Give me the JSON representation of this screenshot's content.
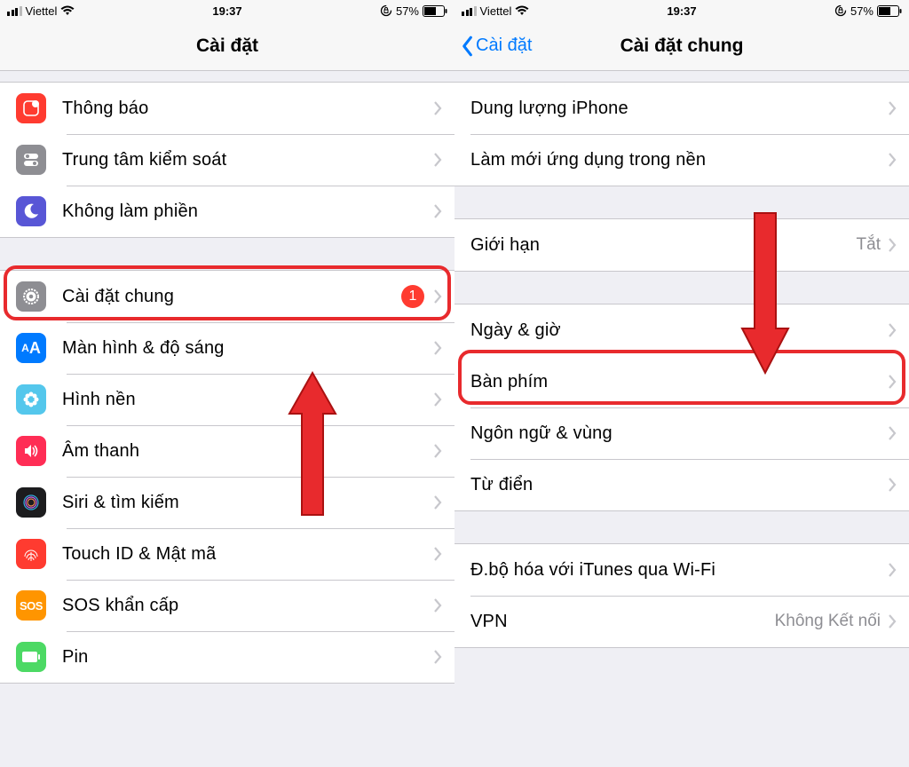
{
  "status": {
    "carrier": "Viettel",
    "time": "19:37",
    "battery": "57%"
  },
  "left": {
    "title": "Cài đặt",
    "badge": "1",
    "rows1": [
      {
        "label": "Thông báo"
      },
      {
        "label": "Trung tâm kiểm soát"
      },
      {
        "label": "Không làm phiền"
      }
    ],
    "rows2": [
      {
        "label": "Cài đặt chung"
      },
      {
        "label": "Màn hình & độ sáng"
      },
      {
        "label": "Hình nền"
      },
      {
        "label": "Âm thanh"
      },
      {
        "label": "Siri & tìm kiếm"
      },
      {
        "label": "Touch ID & Mật mã"
      },
      {
        "label": "SOS khẩn cấp"
      },
      {
        "label": "Pin"
      }
    ]
  },
  "right": {
    "back": "Cài đặt",
    "title": "Cài đặt chung",
    "rows1": [
      {
        "label": "Dung lượng iPhone"
      },
      {
        "label": "Làm mới ứng dụng trong nền"
      }
    ],
    "rows2": [
      {
        "label": "Giới hạn",
        "value": "Tắt"
      }
    ],
    "rows3": [
      {
        "label": "Ngày & giờ"
      },
      {
        "label": "Bàn phím"
      },
      {
        "label": "Ngôn ngữ & vùng"
      },
      {
        "label": "Từ điển"
      }
    ],
    "rows4": [
      {
        "label": "Đ.bộ hóa với iTunes qua Wi-Fi"
      },
      {
        "label": "VPN",
        "value": "Không Kết nối"
      }
    ]
  }
}
